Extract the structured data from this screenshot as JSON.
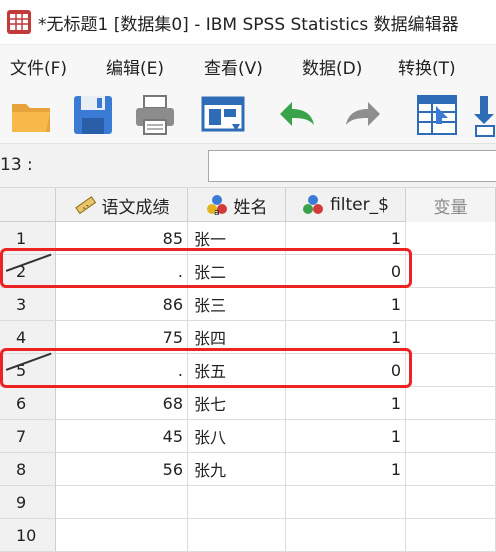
{
  "window": {
    "title": "*无标题1 [数据集0] - IBM SPSS Statistics 数据编辑器"
  },
  "menu": {
    "items": [
      {
        "label": "文件(F)"
      },
      {
        "label": "编辑(E)"
      },
      {
        "label": "查看(V)"
      },
      {
        "label": "数据(D)"
      },
      {
        "label": "转换(T)"
      }
    ]
  },
  "toolbar": {
    "icons": [
      "open-folder-icon",
      "save-disk-icon",
      "print-icon",
      "dialog-recall-icon",
      "undo-icon",
      "redo-icon",
      "goto-case-icon",
      "goto-variable-icon"
    ]
  },
  "cellbar": {
    "reference": "13 :",
    "value": ""
  },
  "grid": {
    "columns": [
      {
        "label": "语文成绩",
        "icon": "ruler-scale-icon"
      },
      {
        "label": "姓名",
        "icon": "nominal-string-icon"
      },
      {
        "label": "filter_$",
        "icon": "nominal-balls-icon"
      },
      {
        "label": "变量",
        "icon": ""
      }
    ],
    "rows": [
      {
        "num": "1",
        "score": "85",
        "name": "张一",
        "filter": "1",
        "filtered_out": false
      },
      {
        "num": "2",
        "score": ".",
        "name": "张二",
        "filter": "0",
        "filtered_out": true
      },
      {
        "num": "3",
        "score": "86",
        "name": "张三",
        "filter": "1",
        "filtered_out": false
      },
      {
        "num": "4",
        "score": "75",
        "name": "张四",
        "filter": "1",
        "filtered_out": false
      },
      {
        "num": "5",
        "score": ".",
        "name": "张五",
        "filter": "0",
        "filtered_out": true
      },
      {
        "num": "6",
        "score": "68",
        "name": "张七",
        "filter": "1",
        "filtered_out": false
      },
      {
        "num": "7",
        "score": "45",
        "name": "张八",
        "filter": "1",
        "filtered_out": false
      },
      {
        "num": "8",
        "score": "56",
        "name": "张九",
        "filter": "1",
        "filtered_out": false
      },
      {
        "num": "9",
        "score": "",
        "name": "",
        "filter": "",
        "filtered_out": false
      },
      {
        "num": "10",
        "score": "",
        "name": "",
        "filter": "",
        "filtered_out": false
      }
    ]
  },
  "highlight_color": "#ee2222"
}
